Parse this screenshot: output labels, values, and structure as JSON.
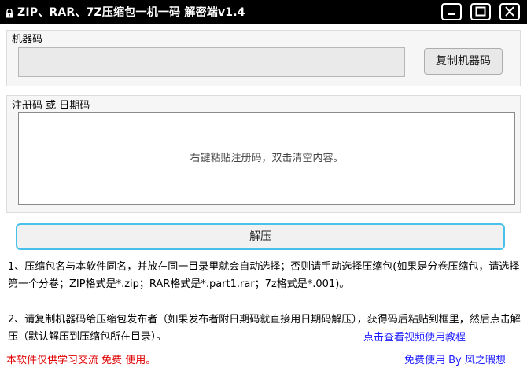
{
  "window": {
    "title": "ZIP、RAR、7Z压缩包一机一码   解密端v1.4",
    "icon": "lock-icon",
    "controls": [
      "minimize-icon",
      "maximize-icon",
      "close-icon"
    ]
  },
  "machine": {
    "label": "机器码",
    "value": "",
    "copy_button": "复制机器码"
  },
  "registration": {
    "label": "注册码 或 日期码",
    "placeholder": "右键粘贴注册码，双击清空内容。"
  },
  "unzip_button": "解压",
  "instructions": {
    "line1": "1、压缩包名与本软件同名，并放在同一目录里就会自动选择；否则请手动选择压缩包(如果是分卷压缩包，请选择第一个分卷；ZIP格式是*.zip；RAR格式是*.part1.rar；7z格式是*.001)。",
    "line2": "2、请复制机器码给压缩包发布者（如果发布者附日期码就直接用日期码解压），获得码后粘贴到框里，然后点击解压（默认解压到压缩包所在目录）。",
    "video_link": "点击查看视频使用教程"
  },
  "footer": {
    "notice": "本软件仅供学习交流  免费  使用。",
    "credit": "免费使用 By 风之暇想"
  },
  "colors": {
    "titlebar": "#000000",
    "accent_border": "#47c0ec",
    "link": "#1a1aff",
    "warning": "#e00000"
  }
}
